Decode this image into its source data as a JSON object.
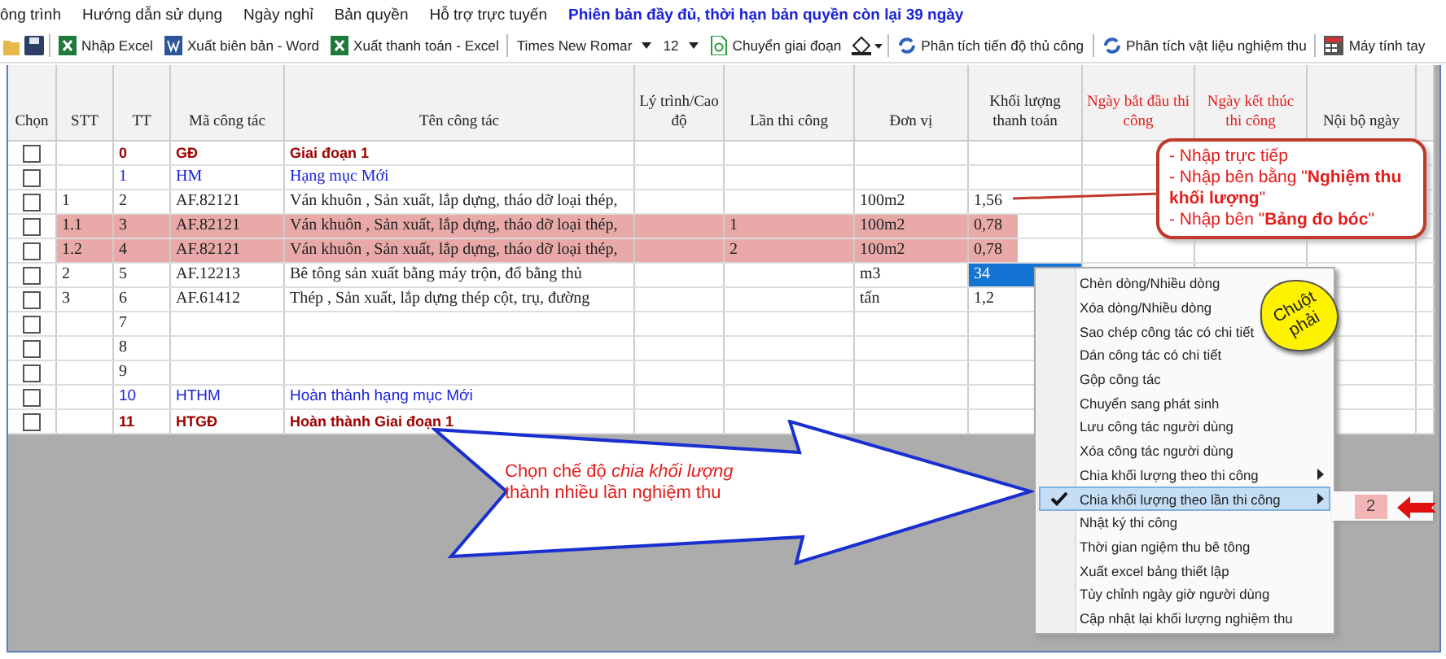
{
  "menu_bar": [
    "ông trình",
    "Hướng dẫn sử dụng",
    "Ngày nghỉ",
    "Bản quyền",
    "Hỗ trợ trực tuyến"
  ],
  "license_notice": "Phiên bản đầy đủ, thời hạn bản quyền còn lại 39 ngày",
  "toolbar": {
    "import_excel": "Nhập Excel",
    "export_word": "Xuất biên bản - Word",
    "export_excel": "Xuất thanh toán - Excel",
    "font_name": "Times New Romar",
    "font_size": "12",
    "change_phase": "Chuyển giai đoạn",
    "progress_analysis": "Phân tích tiến độ thủ công",
    "material_analysis": "Phân tích vật liệu nghiệm thu",
    "calculator": "Máy tính tay"
  },
  "table": {
    "columns": [
      {
        "label": "Chọn",
        "kind": "normal"
      },
      {
        "label": "STT",
        "kind": "normal"
      },
      {
        "label": "TT",
        "kind": "normal"
      },
      {
        "label": "Mã công tác",
        "kind": "normal"
      },
      {
        "label": "Tên công tác",
        "kind": "normal"
      },
      {
        "label": "Lý trình/Cao độ",
        "kind": "normal"
      },
      {
        "label": "Lần thi công",
        "kind": "normal"
      },
      {
        "label": "Đơn vị",
        "kind": "normal"
      },
      {
        "label": "Khối lượng thanh toán",
        "kind": "normal"
      },
      {
        "label": "Ngày bắt đầu thi công",
        "kind": "date"
      },
      {
        "label": "Ngày kết thúc thi công",
        "kind": "date"
      },
      {
        "label": "Nội bộ ngày",
        "kind": "normal"
      }
    ],
    "rows": [
      {
        "kind": "phase",
        "checked": false,
        "highlighted": false,
        "volume_selected": false,
        "tt": "0",
        "code": "GĐ",
        "name": "Giai đoạn 1"
      },
      {
        "kind": "item",
        "checked": false,
        "highlighted": false,
        "volume_selected": false,
        "tt": "1",
        "code": "HM",
        "name": "Hạng mục Mới"
      },
      {
        "kind": "work",
        "checked": false,
        "highlighted": false,
        "volume_selected": false,
        "stt": "1",
        "tt": "2",
        "code": "AF.82121",
        "name": "Ván khuôn , Sản xuất, lắp dựng, tháo dỡ loại thép,",
        "unit": "100m2",
        "volume": "1,56"
      },
      {
        "kind": "work",
        "checked": false,
        "highlighted": true,
        "volume_selected": false,
        "stt": "1.1",
        "tt": "3",
        "code": "AF.82121",
        "name": "Ván khuôn , Sản xuất, lắp dựng, tháo dỡ loại thép,",
        "pass": "1",
        "unit": "100m2",
        "volume": "0,78"
      },
      {
        "kind": "work",
        "checked": false,
        "highlighted": true,
        "volume_selected": false,
        "stt": "1.2",
        "tt": "4",
        "code": "AF.82121",
        "name": "Ván khuôn , Sản xuất, lắp dựng, tháo dỡ loại thép,",
        "pass": "2",
        "unit": "100m2",
        "volume": "0,78"
      },
      {
        "kind": "work",
        "checked": false,
        "highlighted": false,
        "volume_selected": true,
        "stt": "2",
        "tt": "5",
        "code": "AF.12213",
        "name": "Bê tông sản xuất bằng máy trộn, đổ bằng thủ",
        "unit": "m3",
        "volume": "34"
      },
      {
        "kind": "work",
        "checked": false,
        "highlighted": false,
        "volume_selected": false,
        "stt": "3",
        "tt": "6",
        "code": "AF.61412",
        "name": "Thép , Sản xuất, lắp dựng thép cột, trụ, đường",
        "unit": "tấn",
        "volume": "1,2"
      },
      {
        "kind": "work",
        "checked": false,
        "highlighted": false,
        "volume_selected": false,
        "tt": "7"
      },
      {
        "kind": "work",
        "checked": false,
        "highlighted": false,
        "volume_selected": false,
        "tt": "8"
      },
      {
        "kind": "work",
        "checked": false,
        "highlighted": false,
        "volume_selected": false,
        "tt": "9"
      },
      {
        "kind": "item_end",
        "checked": false,
        "highlighted": false,
        "volume_selected": false,
        "tt": "10",
        "code": "HTHM",
        "name": "Hoàn thành hạng mục Mới"
      },
      {
        "kind": "phase_end",
        "checked": false,
        "highlighted": false,
        "volume_selected": false,
        "tt": "11",
        "code": "HTGĐ",
        "name": "Hoàn thành Giai đoạn 1"
      }
    ]
  },
  "input_callout": [
    "- Nhập trực tiếp",
    "- Nhập bên bằng \"**Nghiệm thu khối lượng**\"",
    "- Nhập bên \"**Bảng đo bóc**\""
  ],
  "context_menu": [
    {
      "label": "Chèn dòng/Nhiều dòng",
      "checked": false,
      "submenu": false,
      "selected": false
    },
    {
      "label": "Xóa dòng/Nhiều dòng",
      "checked": false,
      "submenu": false,
      "selected": false
    },
    {
      "label": "Sao chép công tác có chi tiết",
      "checked": false,
      "submenu": false,
      "selected": false
    },
    {
      "label": "Dán công tác có chi tiết",
      "checked": false,
      "submenu": false,
      "selected": false
    },
    {
      "label": "Gộp công tác",
      "checked": false,
      "submenu": false,
      "selected": false
    },
    {
      "label": "Chuyển sang phát sinh",
      "checked": false,
      "submenu": false,
      "selected": false
    },
    {
      "label": "Lưu công tác người dùng",
      "checked": false,
      "submenu": false,
      "selected": false
    },
    {
      "label": "Xóa công tác người dùng",
      "checked": false,
      "submenu": false,
      "selected": false
    },
    {
      "label": "Chia khối lượng theo thi công",
      "checked": false,
      "submenu": true,
      "selected": false
    },
    {
      "label": "Chia khối lượng theo lần thi công",
      "checked": true,
      "submenu": true,
      "selected": true
    },
    {
      "label": "Nhật ký thi công",
      "checked": false,
      "submenu": false,
      "selected": false
    },
    {
      "label": "Thời gian ngiệm thu bê tông",
      "checked": false,
      "submenu": false,
      "selected": false
    },
    {
      "label": "Xuất excel bảng thiết lập",
      "checked": false,
      "submenu": false,
      "selected": false
    },
    {
      "label": "Tùy chỉnh ngày giờ người dùng",
      "checked": false,
      "submenu": false,
      "selected": false
    },
    {
      "label": "Cập nhật lại khối lượng nghiệm thu",
      "checked": false,
      "submenu": false,
      "selected": false
    }
  ],
  "submenu": {
    "value": "2",
    "selected": true
  },
  "cloud_note": "Chuột phải",
  "arrow_note": "Chọn chế độ *chia khối lượng* thành nhiều lần nghiệm thu"
}
